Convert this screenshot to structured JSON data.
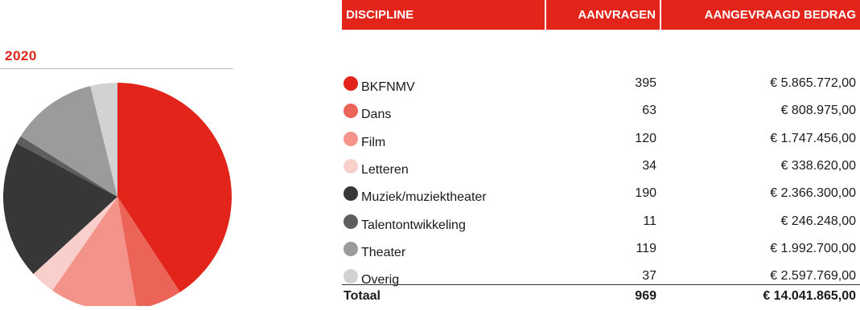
{
  "year": "2020",
  "headers": {
    "discipline": "DISCIPLINE",
    "aanvragen": "AANVRAGEN",
    "bedrag": "AANGEVRAAGD BEDRAG"
  },
  "rows": [
    {
      "label": "BKFNMV",
      "aanvragen": "395",
      "bedrag": "€ 5.865.772,00",
      "color": "#e2241a"
    },
    {
      "label": "Dans",
      "aanvragen": "63",
      "bedrag": "€ 808.975,00",
      "color": "#ec6458"
    },
    {
      "label": "Film",
      "aanvragen": "120",
      "bedrag": "€ 1.747.456,00",
      "color": "#f39389"
    },
    {
      "label": "Letteren",
      "aanvragen": "34",
      "bedrag": "€ 338.620,00",
      "color": "#f9cfcb"
    },
    {
      "label": "Muziek/muziektheater",
      "aanvragen": "190",
      "bedrag": "€ 2.366.300,00",
      "color": "#373737"
    },
    {
      "label": "Talentontwikkeling",
      "aanvragen": "11",
      "bedrag": "€ 246.248,00",
      "color": "#5e5e5e"
    },
    {
      "label": "Theater",
      "aanvragen": "119",
      "bedrag": "€ 1.992.700,00",
      "color": "#9b9b9b"
    },
    {
      "label": "Overig",
      "aanvragen": "37",
      "bedrag": "€ 2.597.769,00",
      "color": "#d2d2d2"
    }
  ],
  "total": {
    "label": "Totaal",
    "aanvragen": "969",
    "bedrag": "€ 14.041.865,00"
  },
  "chart_data": {
    "type": "pie",
    "categories": [
      "BKFNMV",
      "Dans",
      "Film",
      "Letteren",
      "Muziek/muziektheater",
      "Talentontwikkeling",
      "Theater",
      "Overig"
    ],
    "values": [
      395,
      63,
      120,
      34,
      190,
      11,
      119,
      37
    ],
    "colors": [
      "#e2241a",
      "#ec6458",
      "#f39389",
      "#f9cfcb",
      "#373737",
      "#5e5e5e",
      "#9b9b9b",
      "#d2d2d2"
    ],
    "title": "2020"
  }
}
